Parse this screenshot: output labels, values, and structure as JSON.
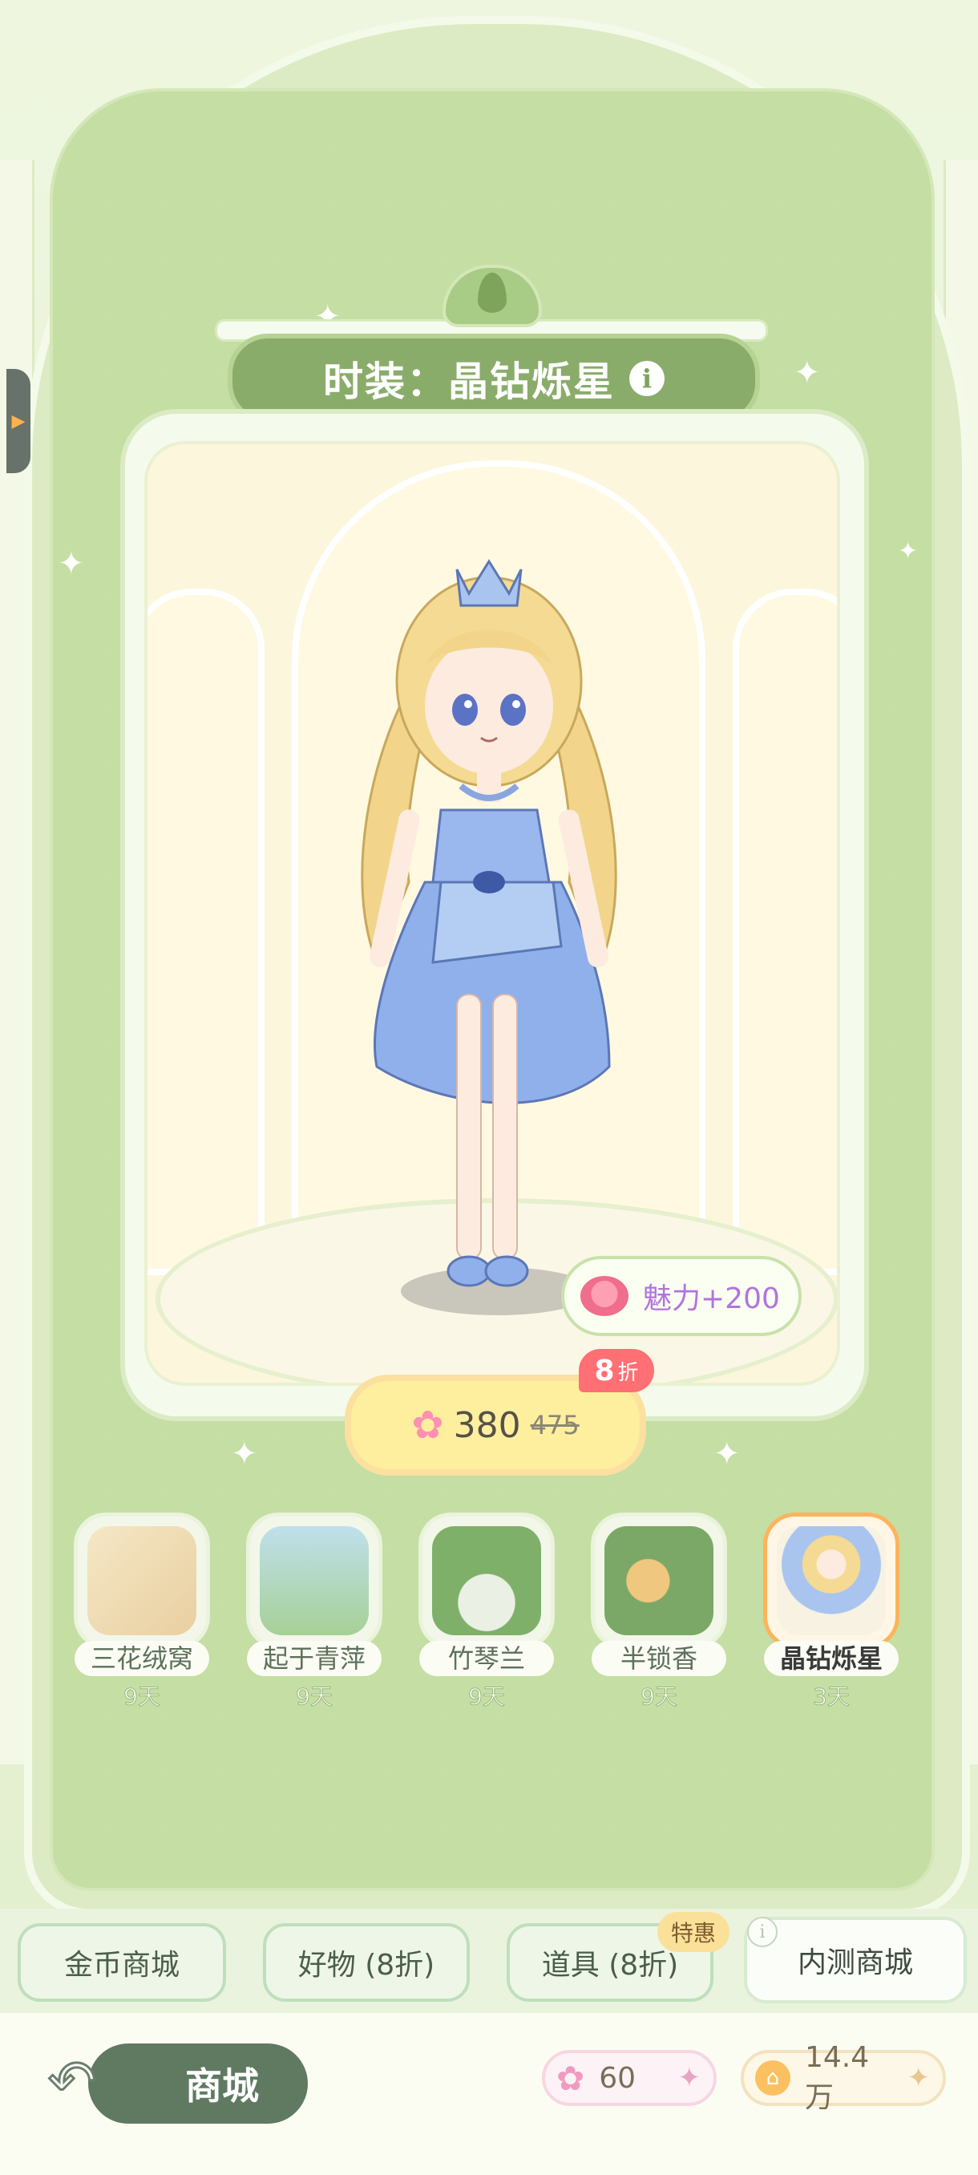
{
  "header": {
    "title": "时装：晶钻烁星",
    "info_icon": "i"
  },
  "preview": {
    "charm_label": "魅力+200",
    "price_now": "380",
    "price_old": "475",
    "discount_number": "8",
    "discount_unit": "折"
  },
  "items": [
    {
      "label": "三花绒窝",
      "days": "9天"
    },
    {
      "label": "起于青萍",
      "days": "9天"
    },
    {
      "label": "竹琴兰",
      "days": "9天"
    },
    {
      "label": "半锁香",
      "days": "9天"
    },
    {
      "label": "晶钻烁星",
      "days": "3天"
    }
  ],
  "tabs": [
    {
      "label": "金币商城"
    },
    {
      "label": "好物 (8折)"
    },
    {
      "label": "道具 (8折)"
    },
    {
      "label": "内测商城"
    }
  ],
  "tab_badge": "特惠",
  "bottom": {
    "back_label": "商城",
    "stars_value": "60",
    "coins_value": "14.4万"
  },
  "colors": {
    "background": "#c4dea3",
    "accent_green": "#5f7a60",
    "price_pill": "#fdef9e",
    "discount_red": "#ff6f74",
    "charm_purple": "#b174de"
  }
}
